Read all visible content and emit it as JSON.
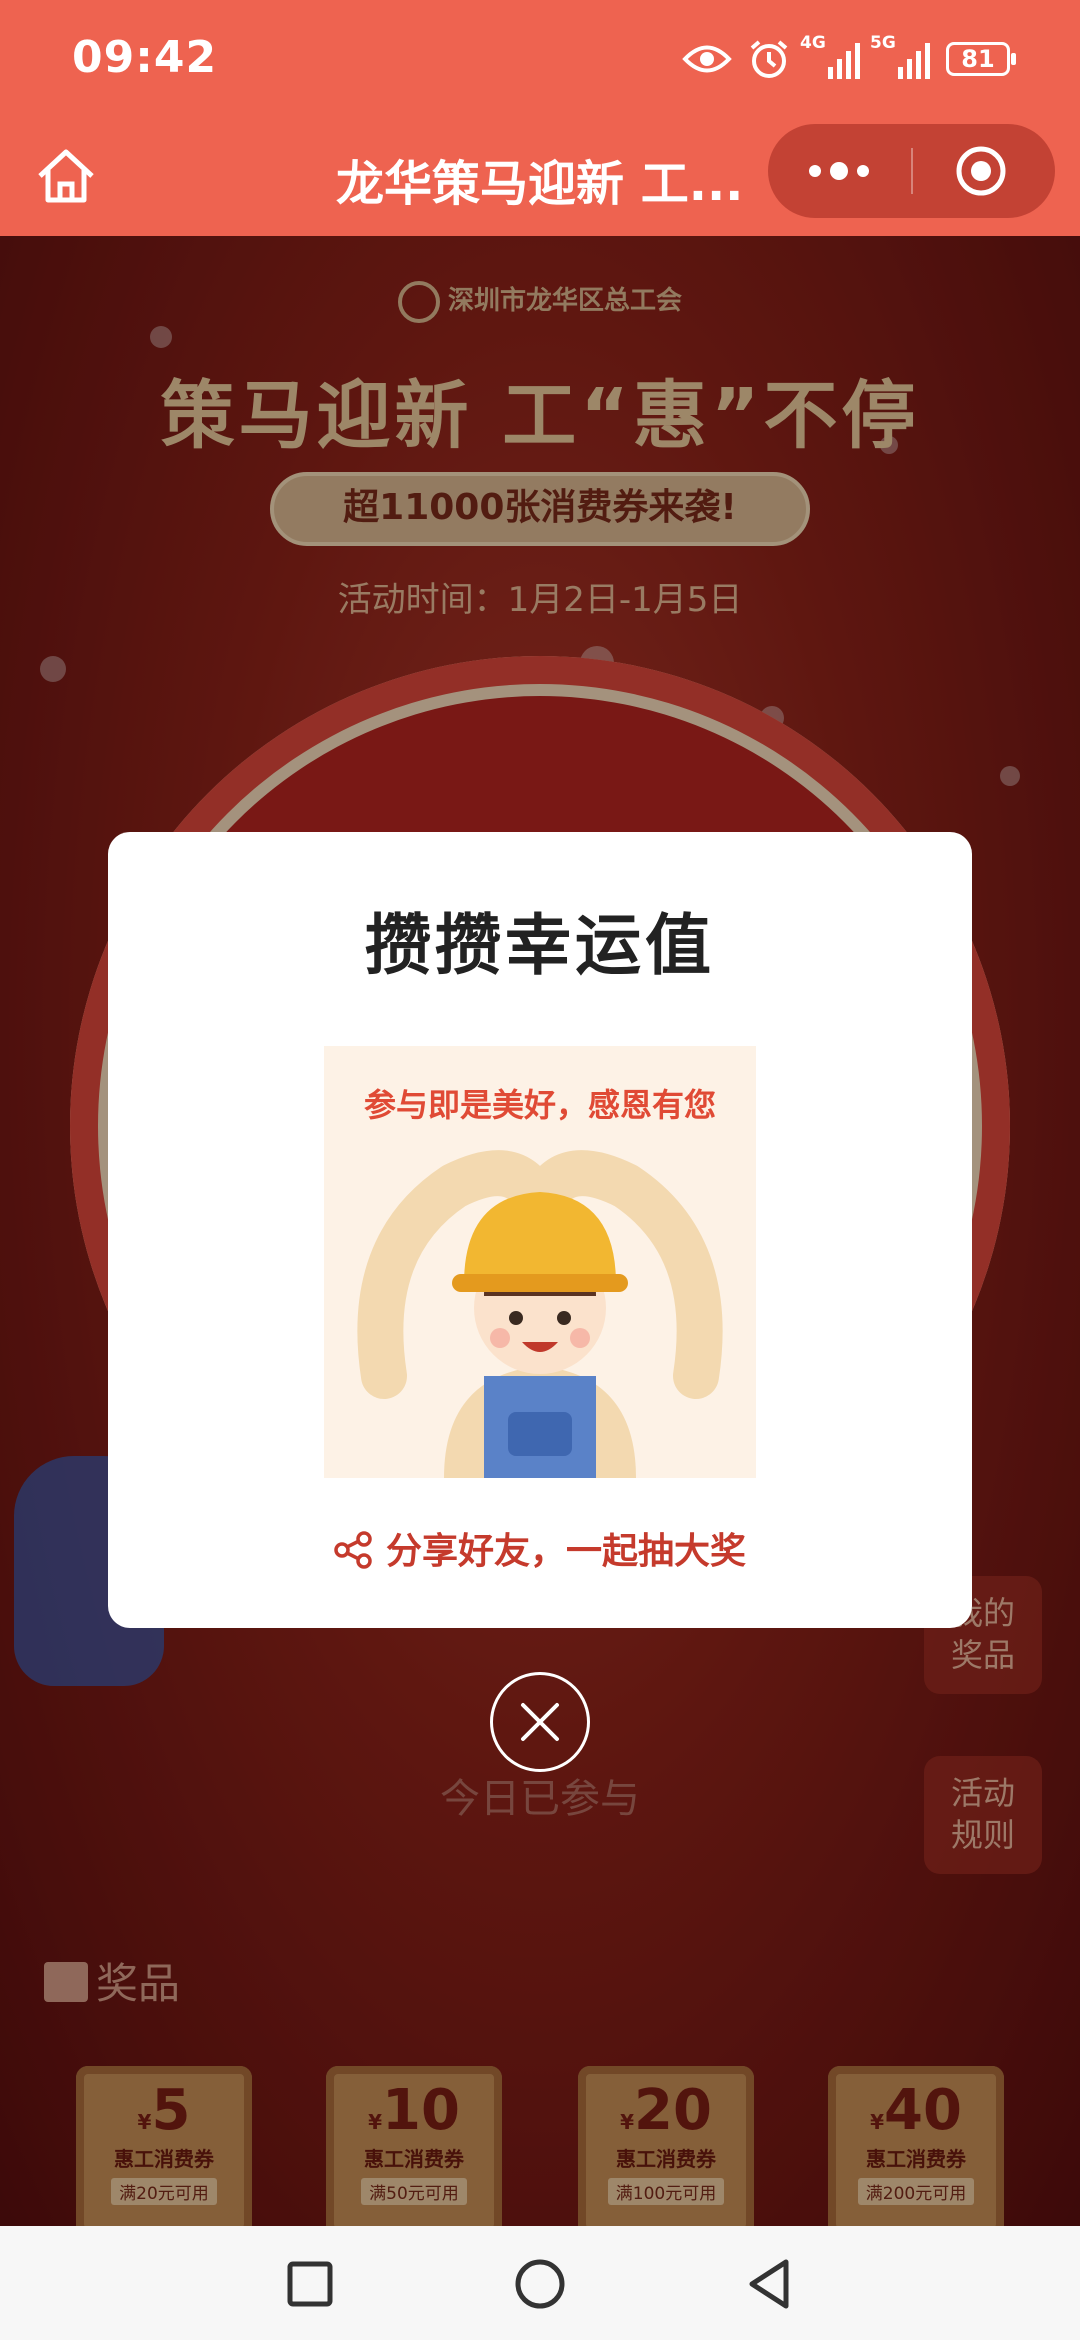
{
  "status_bar": {
    "time": "09:42",
    "net1": "4G",
    "net2": "5G",
    "battery": "81"
  },
  "title_bar": {
    "title": "龙华策马迎新 工..."
  },
  "page": {
    "union_name": "深圳市龙华区总工会",
    "headline": "策马迎新 工“惠”不停",
    "promo": "超11000张消费券来袭!",
    "period": "活动时间：1月2日-1月5日",
    "my_prizes": [
      "我的",
      "奖品"
    ],
    "rules": [
      "活动",
      "规则"
    ],
    "participated": "今日已参与",
    "prizes_heading": "奖品",
    "coupons": [
      {
        "currency": "¥",
        "amount": "5",
        "label": "惠工消费券",
        "condition": "满20元可用"
      },
      {
        "currency": "¥",
        "amount": "10",
        "label": "惠工消费券",
        "condition": "满50元可用"
      },
      {
        "currency": "¥",
        "amount": "20",
        "label": "惠工消费券",
        "condition": "满100元可用"
      },
      {
        "currency": "¥",
        "amount": "40",
        "label": "惠工消费券",
        "condition": "满200元可用"
      }
    ]
  },
  "modal": {
    "title": "攒攒幸运值",
    "image_caption": "参与即是美好，感恩有您",
    "share_label": "分享好友，一起抽大奖"
  },
  "colors": {
    "header": "#ee6350",
    "accent": "#c53a2c"
  }
}
